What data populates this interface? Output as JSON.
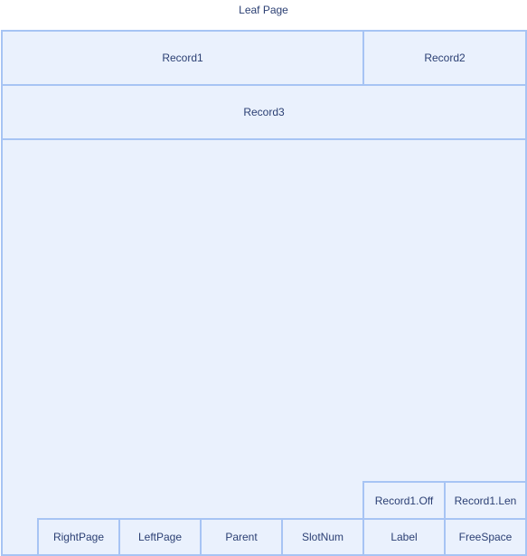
{
  "title": "Leaf Page",
  "colors": {
    "fill": "#eaf1fd",
    "stroke": "#a7c4f4",
    "text": "#2b3f73"
  },
  "records": {
    "record1": "Record1",
    "record2": "Record2",
    "record3": "Record3"
  },
  "slot_array": {
    "record1_off": "Record1.Off",
    "record1_len": "Record1.Len"
  },
  "header": {
    "right_page": "RightPage",
    "left_page": "LeftPage",
    "parent": "Parent",
    "slot_num": "SlotNum",
    "label": "Label",
    "free_space": "FreeSpace"
  }
}
